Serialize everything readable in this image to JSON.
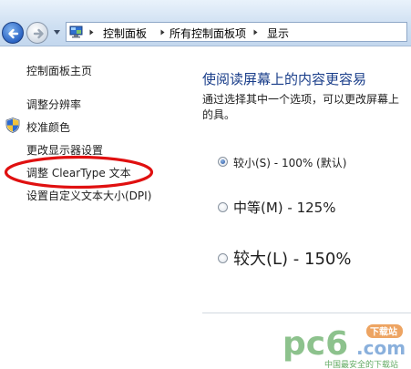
{
  "breadcrumb": {
    "items": [
      "控制面板",
      "所有控制面板项",
      "显示"
    ]
  },
  "sidebar": {
    "items": [
      {
        "label": "控制面板主页"
      },
      {
        "label": "调整分辨率"
      },
      {
        "label": "校准颜色"
      },
      {
        "label": "更改显示器设置"
      },
      {
        "label": "调整 ClearType 文本"
      },
      {
        "label": "设置自定义文本大小(DPI)"
      }
    ]
  },
  "main": {
    "heading": "使阅读屏幕上的内容更容易",
    "description": "通过选择其中一个选项，可以更改屏幕上的具。",
    "options": [
      {
        "label": "较小(S) - 100% (默认)",
        "selected": true
      },
      {
        "label": "中等(M) - 125%",
        "selected": false
      },
      {
        "label": "较大(L) - 150%",
        "selected": false
      }
    ]
  },
  "watermark": {
    "brand": "pc6",
    "domain": ".com",
    "badge": "下载站",
    "tagline": "中国最安全的下载站"
  },
  "colors": {
    "heading": "#1a3e8a",
    "highlight_ring": "#e01010",
    "watermark_green": "#2f8f2f",
    "watermark_blue": "#2a6fc0"
  }
}
